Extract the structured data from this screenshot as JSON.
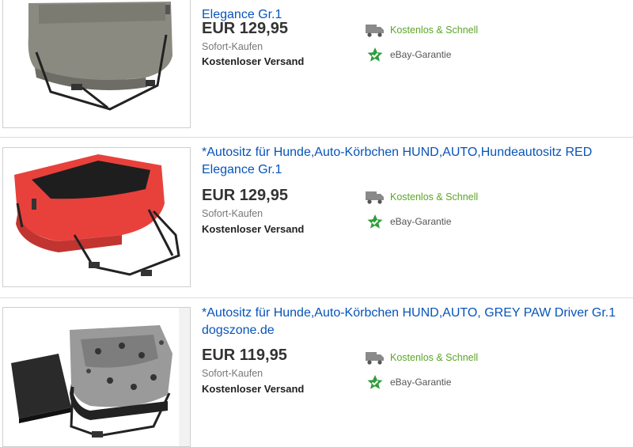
{
  "listings": [
    {
      "title_lines": [
        "",
        "Elegance Gr.1"
      ],
      "price": "EUR 129,95",
      "buy_format": "Sofort-Kaufen",
      "shipping": "Kostenloser Versand",
      "features": {
        "fast_shipping": "Kostenlos & Schnell",
        "guarantee": "eBay-Garantie"
      },
      "image": {
        "seat_color": "#8a8a80",
        "icon": "dog-car-seat-grey-image"
      }
    },
    {
      "title_lines": [
        "*Autositz für Hunde,Auto-Körbchen HUND,AUTO,Hundeautositz RED",
        "Elegance Gr.1"
      ],
      "price": "EUR 129,95",
      "buy_format": "Sofort-Kaufen",
      "shipping": "Kostenloser Versand",
      "features": {
        "fast_shipping": "Kostenlos & Schnell",
        "guarantee": "eBay-Garantie"
      },
      "image": {
        "seat_color": "#e8413c",
        "icon": "dog-car-seat-red-image"
      }
    },
    {
      "title_lines": [
        "*Autositz für Hunde,Auto-Körbchen HUND,AUTO, GREY PAW Driver Gr.1",
        "dogszone.de"
      ],
      "price": "EUR 119,95",
      "buy_format": "Sofort-Kaufen",
      "shipping": "Kostenloser Versand",
      "features": {
        "fast_shipping": "Kostenlos & Schnell",
        "guarantee": "eBay-Garantie"
      },
      "image": {
        "seat_color": "#9a9a9a",
        "icon": "dog-car-seat-paw-image"
      }
    }
  ],
  "colors": {
    "link": "#0654ba",
    "free_shipping_text": "#5ba626",
    "guarantee_star": "#2e9e3b",
    "truck": "#8a8a8a"
  }
}
